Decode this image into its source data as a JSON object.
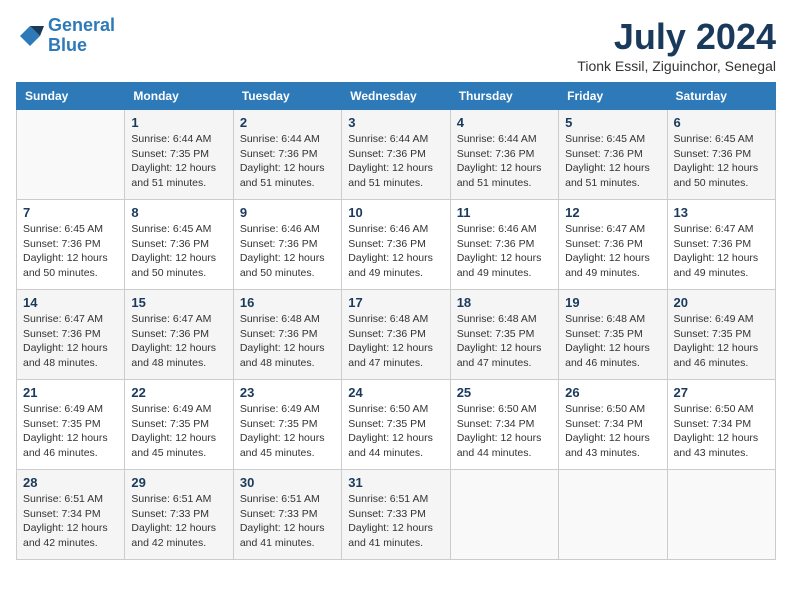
{
  "logo": {
    "line1": "General",
    "line2": "Blue"
  },
  "title": "July 2024",
  "subtitle": "Tionk Essil, Ziguinchor, Senegal",
  "days_of_week": [
    "Sunday",
    "Monday",
    "Tuesday",
    "Wednesday",
    "Thursday",
    "Friday",
    "Saturday"
  ],
  "weeks": [
    [
      {
        "day": "",
        "info": ""
      },
      {
        "day": "1",
        "info": "Sunrise: 6:44 AM\nSunset: 7:35 PM\nDaylight: 12 hours\nand 51 minutes."
      },
      {
        "day": "2",
        "info": "Sunrise: 6:44 AM\nSunset: 7:36 PM\nDaylight: 12 hours\nand 51 minutes."
      },
      {
        "day": "3",
        "info": "Sunrise: 6:44 AM\nSunset: 7:36 PM\nDaylight: 12 hours\nand 51 minutes."
      },
      {
        "day": "4",
        "info": "Sunrise: 6:44 AM\nSunset: 7:36 PM\nDaylight: 12 hours\nand 51 minutes."
      },
      {
        "day": "5",
        "info": "Sunrise: 6:45 AM\nSunset: 7:36 PM\nDaylight: 12 hours\nand 51 minutes."
      },
      {
        "day": "6",
        "info": "Sunrise: 6:45 AM\nSunset: 7:36 PM\nDaylight: 12 hours\nand 50 minutes."
      }
    ],
    [
      {
        "day": "7",
        "info": "Sunrise: 6:45 AM\nSunset: 7:36 PM\nDaylight: 12 hours\nand 50 minutes."
      },
      {
        "day": "8",
        "info": "Sunrise: 6:45 AM\nSunset: 7:36 PM\nDaylight: 12 hours\nand 50 minutes."
      },
      {
        "day": "9",
        "info": "Sunrise: 6:46 AM\nSunset: 7:36 PM\nDaylight: 12 hours\nand 50 minutes."
      },
      {
        "day": "10",
        "info": "Sunrise: 6:46 AM\nSunset: 7:36 PM\nDaylight: 12 hours\nand 49 minutes."
      },
      {
        "day": "11",
        "info": "Sunrise: 6:46 AM\nSunset: 7:36 PM\nDaylight: 12 hours\nand 49 minutes."
      },
      {
        "day": "12",
        "info": "Sunrise: 6:47 AM\nSunset: 7:36 PM\nDaylight: 12 hours\nand 49 minutes."
      },
      {
        "day": "13",
        "info": "Sunrise: 6:47 AM\nSunset: 7:36 PM\nDaylight: 12 hours\nand 49 minutes."
      }
    ],
    [
      {
        "day": "14",
        "info": "Sunrise: 6:47 AM\nSunset: 7:36 PM\nDaylight: 12 hours\nand 48 minutes."
      },
      {
        "day": "15",
        "info": "Sunrise: 6:47 AM\nSunset: 7:36 PM\nDaylight: 12 hours\nand 48 minutes."
      },
      {
        "day": "16",
        "info": "Sunrise: 6:48 AM\nSunset: 7:36 PM\nDaylight: 12 hours\nand 48 minutes."
      },
      {
        "day": "17",
        "info": "Sunrise: 6:48 AM\nSunset: 7:36 PM\nDaylight: 12 hours\nand 47 minutes."
      },
      {
        "day": "18",
        "info": "Sunrise: 6:48 AM\nSunset: 7:35 PM\nDaylight: 12 hours\nand 47 minutes."
      },
      {
        "day": "19",
        "info": "Sunrise: 6:48 AM\nSunset: 7:35 PM\nDaylight: 12 hours\nand 46 minutes."
      },
      {
        "day": "20",
        "info": "Sunrise: 6:49 AM\nSunset: 7:35 PM\nDaylight: 12 hours\nand 46 minutes."
      }
    ],
    [
      {
        "day": "21",
        "info": "Sunrise: 6:49 AM\nSunset: 7:35 PM\nDaylight: 12 hours\nand 46 minutes."
      },
      {
        "day": "22",
        "info": "Sunrise: 6:49 AM\nSunset: 7:35 PM\nDaylight: 12 hours\nand 45 minutes."
      },
      {
        "day": "23",
        "info": "Sunrise: 6:49 AM\nSunset: 7:35 PM\nDaylight: 12 hours\nand 45 minutes."
      },
      {
        "day": "24",
        "info": "Sunrise: 6:50 AM\nSunset: 7:35 PM\nDaylight: 12 hours\nand 44 minutes."
      },
      {
        "day": "25",
        "info": "Sunrise: 6:50 AM\nSunset: 7:34 PM\nDaylight: 12 hours\nand 44 minutes."
      },
      {
        "day": "26",
        "info": "Sunrise: 6:50 AM\nSunset: 7:34 PM\nDaylight: 12 hours\nand 43 minutes."
      },
      {
        "day": "27",
        "info": "Sunrise: 6:50 AM\nSunset: 7:34 PM\nDaylight: 12 hours\nand 43 minutes."
      }
    ],
    [
      {
        "day": "28",
        "info": "Sunrise: 6:51 AM\nSunset: 7:34 PM\nDaylight: 12 hours\nand 42 minutes."
      },
      {
        "day": "29",
        "info": "Sunrise: 6:51 AM\nSunset: 7:33 PM\nDaylight: 12 hours\nand 42 minutes."
      },
      {
        "day": "30",
        "info": "Sunrise: 6:51 AM\nSunset: 7:33 PM\nDaylight: 12 hours\nand 41 minutes."
      },
      {
        "day": "31",
        "info": "Sunrise: 6:51 AM\nSunset: 7:33 PM\nDaylight: 12 hours\nand 41 minutes."
      },
      {
        "day": "",
        "info": ""
      },
      {
        "day": "",
        "info": ""
      },
      {
        "day": "",
        "info": ""
      }
    ]
  ]
}
